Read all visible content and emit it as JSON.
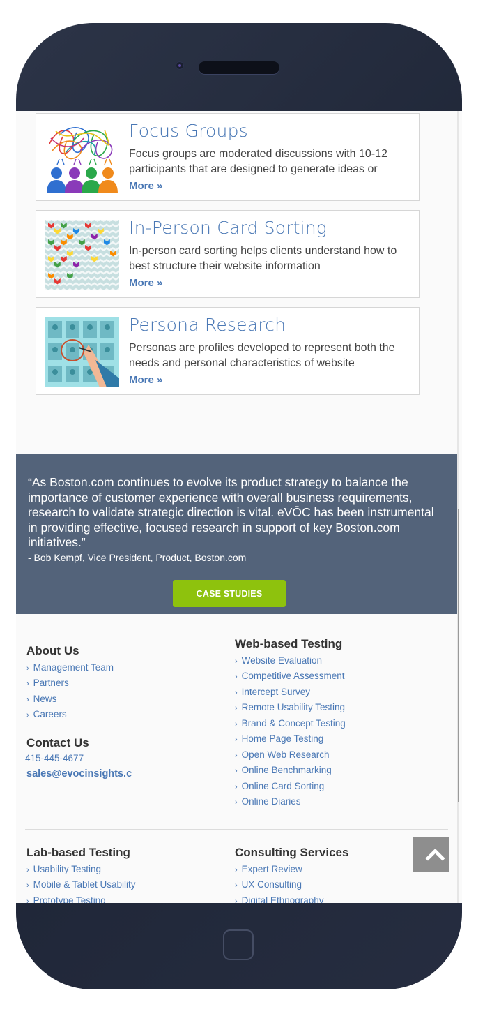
{
  "services": [
    {
      "title": "Focus Groups",
      "description": "Focus groups are moderated discussions with 10-12 participants that are designed to generate ideas or",
      "more_label": "More »"
    },
    {
      "title": "In-Person Card Sorting",
      "description": "In-person card sorting helps clients understand how to best structure their website information",
      "more_label": "More »"
    },
    {
      "title": "Persona Research",
      "description": "Personas are profiles developed to represent both the needs and personal characteristics of website",
      "more_label": "More »"
    }
  ],
  "testimonial": {
    "quote": "“As Boston.com continues to evolve its product strategy to balance the importance of customer experience with overall business requirements, research to validate strategic direction is vital. eVŌC has been instrumental in providing effective, focused research in support of key Boston.com initiatives.”",
    "author": "- Bob Kempf, Vice President, Product, Boston.com",
    "button_label": "CASE STUDIES"
  },
  "footer": {
    "about": {
      "heading": "About Us",
      "links": [
        "Management Team",
        "Partners",
        "News",
        "Careers"
      ]
    },
    "contact": {
      "heading": "Contact Us",
      "phone": "415-445-4677",
      "email": "sales@evocinsights.c"
    },
    "web_testing": {
      "heading": "Web-based Testing",
      "links": [
        "Website Evaluation",
        "Competitive Assessment",
        "Intercept Survey",
        "Remote Usability Testing",
        "Brand & Concept Testing",
        "Home Page Testing",
        "Open Web Research",
        "Online Benchmarking",
        "Online Card Sorting",
        "Online Diaries"
      ]
    },
    "lab_testing": {
      "heading": "Lab-based Testing",
      "links": [
        "Usability Testing",
        "Mobile & Tablet Usability",
        "Prototype Testing"
      ]
    },
    "consulting": {
      "heading": "Consulting Services",
      "links": [
        "Expert Review",
        "UX Consulting",
        "Digital Ethnography"
      ]
    }
  },
  "colors": {
    "accent": "#4a78b5",
    "testimonial_bg": "#53637a",
    "cta_green": "#8ec20d",
    "back_to_top_bg": "#8e8e8e"
  },
  "icons": {
    "chevron": "chevron-right-icon",
    "back_to_top": "chevron-up-icon"
  }
}
